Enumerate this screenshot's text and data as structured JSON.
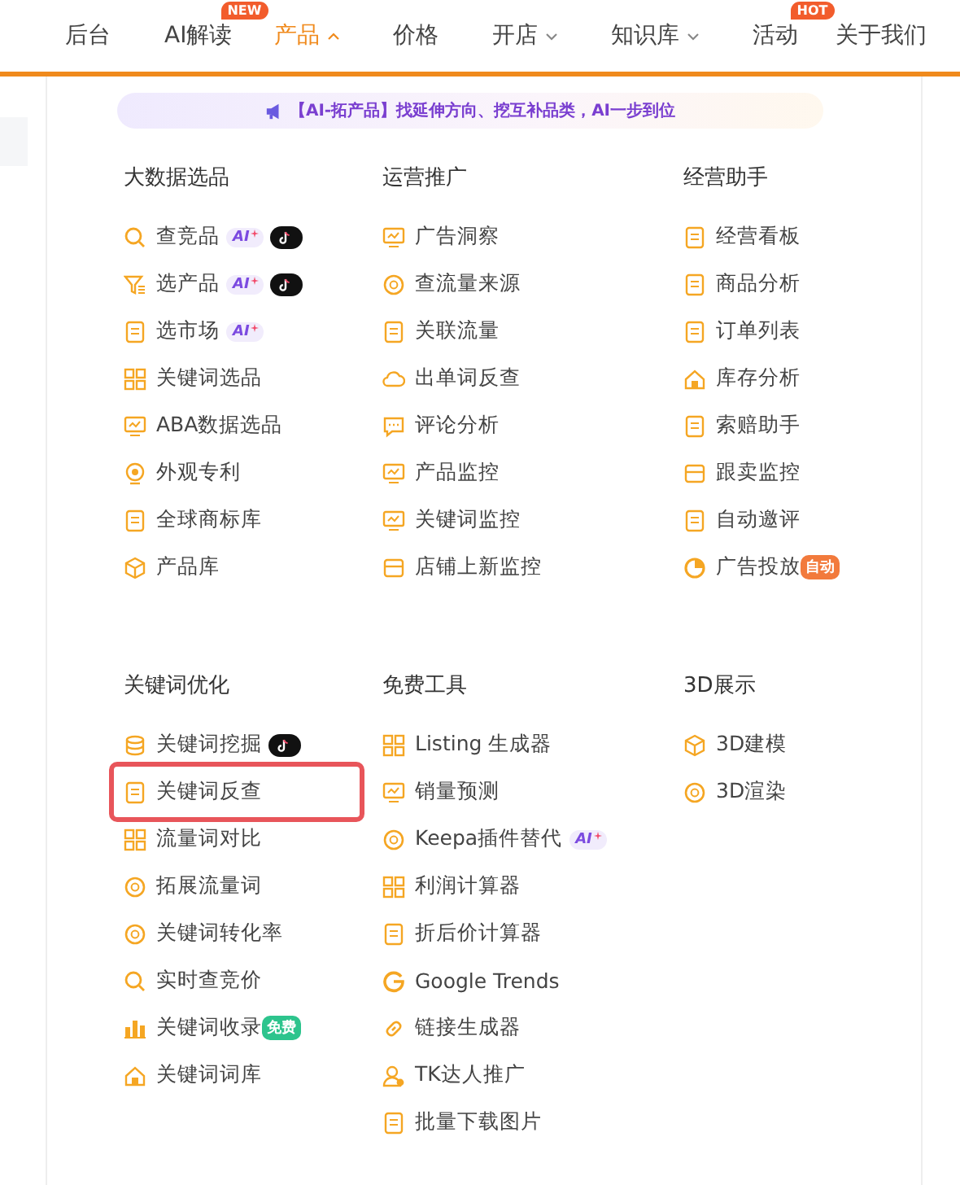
{
  "nav": {
    "items": [
      {
        "label": "后台",
        "selected": false
      },
      {
        "label": "AI解读",
        "selected": false,
        "badge": "NEW"
      },
      {
        "label": "产品",
        "selected": true,
        "caret": true
      },
      {
        "label": "价格",
        "selected": false
      },
      {
        "label": "开店",
        "selected": false,
        "caret": true
      },
      {
        "label": "知识库",
        "selected": false,
        "caret": true
      },
      {
        "label": "活动",
        "selected": false,
        "badge": "HOT"
      },
      {
        "label": "关于我们",
        "selected": false
      }
    ]
  },
  "banner": {
    "text": "【AI-拓产品】找延伸方向、挖互补品类，AI一步到位"
  },
  "groups": [
    {
      "sections": [
        {
          "title": "大数据选品",
          "items": [
            {
              "label": "查竞品",
              "badges": [
                {
                  "kind": "ai",
                  "text": "AI"
                },
                {
                  "kind": "tiktok"
                }
              ]
            },
            {
              "label": "选产品",
              "badges": [
                {
                  "kind": "ai",
                  "text": "AI"
                },
                {
                  "kind": "tiktok"
                }
              ]
            },
            {
              "label": "选市场",
              "badges": [
                {
                  "kind": "ai",
                  "text": "AI"
                }
              ]
            },
            {
              "label": "关键词选品"
            },
            {
              "label": "ABA数据选品"
            },
            {
              "label": "外观专利"
            },
            {
              "label": "全球商标库"
            },
            {
              "label": "产品库"
            }
          ]
        },
        {
          "title": "运营推广",
          "items": [
            {
              "label": "广告洞察"
            },
            {
              "label": "查流量来源"
            },
            {
              "label": "关联流量"
            },
            {
              "label": "出单词反查"
            },
            {
              "label": "评论分析"
            },
            {
              "label": "产品监控"
            },
            {
              "label": "关键词监控"
            },
            {
              "label": "店铺上新监控"
            }
          ]
        },
        {
          "title": "经营助手",
          "items": [
            {
              "label": "经营看板"
            },
            {
              "label": "商品分析"
            },
            {
              "label": "订单列表"
            },
            {
              "label": "库存分析"
            },
            {
              "label": "索赔助手"
            },
            {
              "label": "跟卖监控"
            },
            {
              "label": "自动邀评"
            },
            {
              "label": "广告投放",
              "badges": [
                {
                  "kind": "auto",
                  "text": "自动"
                }
              ]
            }
          ]
        }
      ]
    },
    {
      "sections": [
        {
          "title": "关键词优化",
          "items": [
            {
              "label": "关键词挖掘",
              "badges": [
                {
                  "kind": "tiktok"
                }
              ]
            },
            {
              "label": "关键词反查",
              "highlighted": true
            },
            {
              "label": "流量词对比"
            },
            {
              "label": "拓展流量词"
            },
            {
              "label": "关键词转化率"
            },
            {
              "label": "实时查竞价"
            },
            {
              "label": "关键词收录",
              "badges": [
                {
                  "kind": "free",
                  "text": "免费"
                }
              ]
            },
            {
              "label": "关键词词库"
            }
          ]
        },
        {
          "title": "免费工具",
          "items": [
            {
              "label": "Listing 生成器"
            },
            {
              "label": "销量预测"
            },
            {
              "label": "Keepa插件替代",
              "badges": [
                {
                  "kind": "ai",
                  "text": "AI"
                }
              ]
            },
            {
              "label": "利润计算器"
            },
            {
              "label": "折后价计算器"
            },
            {
              "label": "Google Trends"
            },
            {
              "label": "链接生成器"
            },
            {
              "label": "TK达人推广"
            },
            {
              "label": "批量下载图片"
            }
          ]
        },
        {
          "title": "3D展示",
          "items": [
            {
              "label": "3D建模"
            },
            {
              "label": "3D渲染"
            }
          ]
        }
      ]
    }
  ]
}
